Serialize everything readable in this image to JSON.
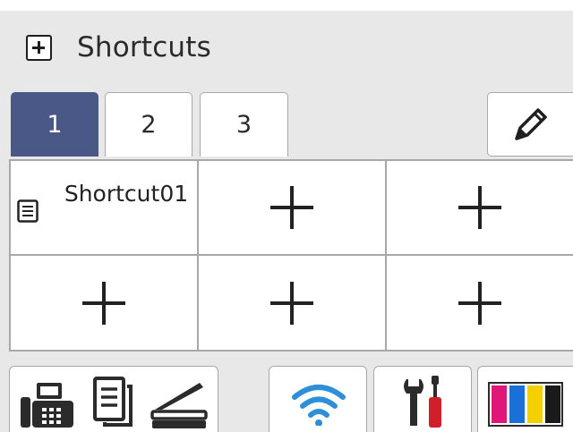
{
  "header": {
    "title": "Shortcuts",
    "icon": "add-box-icon"
  },
  "tabs": [
    {
      "label": "1",
      "active": true
    },
    {
      "label": "2",
      "active": false
    },
    {
      "label": "3",
      "active": false
    }
  ],
  "edit_icon": "pencil-icon",
  "shortcut": {
    "label": "Shortcut01",
    "icon": "copy-document-icon"
  },
  "bottom_icons": [
    "fax-icon",
    "copy-icon",
    "scan-icon",
    "wifi-icon",
    "tools-icon",
    "ink-icon"
  ],
  "colors": {
    "panel_bg": "#e8e8e8",
    "active_tab": "#4a5888",
    "wifi": "#2e8fd8",
    "tool_red": "#d01f2b",
    "ink_magenta": "#e01778",
    "ink_cyan": "#1a6fd8",
    "ink_yellow": "#f4d000",
    "ink_black": "#1a1a1a"
  }
}
